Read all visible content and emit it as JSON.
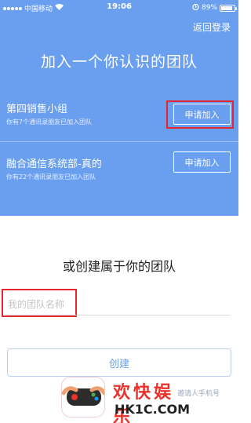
{
  "status_bar": {
    "carrier": "中国移动",
    "wifi_icon": "wifi-icon",
    "time": "19:06",
    "alarm_icon": "alarm-icon",
    "battery_percent": "89%",
    "battery_level": 0.89
  },
  "header": {
    "back_login": "返回登录",
    "title": "加入一个你认识的团队"
  },
  "teams": [
    {
      "name": "第四销售小组",
      "subtitle": "你有7个通讯录朋友已加入团队",
      "join_label": "申请加入"
    },
    {
      "name": "融合通信系统部-真的",
      "subtitle": "你有22个通讯录朋友已加入团队",
      "join_label": "申请加入"
    }
  ],
  "create": {
    "title": "或创建属于你的团队",
    "name_placeholder": "我的团队名称",
    "name_value": "",
    "button_label": "创建",
    "invite_text": "邀请人手机号"
  },
  "watermark": {
    "title": "欢快娱乐",
    "url": "HK1C.COM"
  },
  "colors": {
    "accent": "#6a9ff0",
    "highlight": "#e5262f",
    "watermark_red": "#e8332c"
  }
}
